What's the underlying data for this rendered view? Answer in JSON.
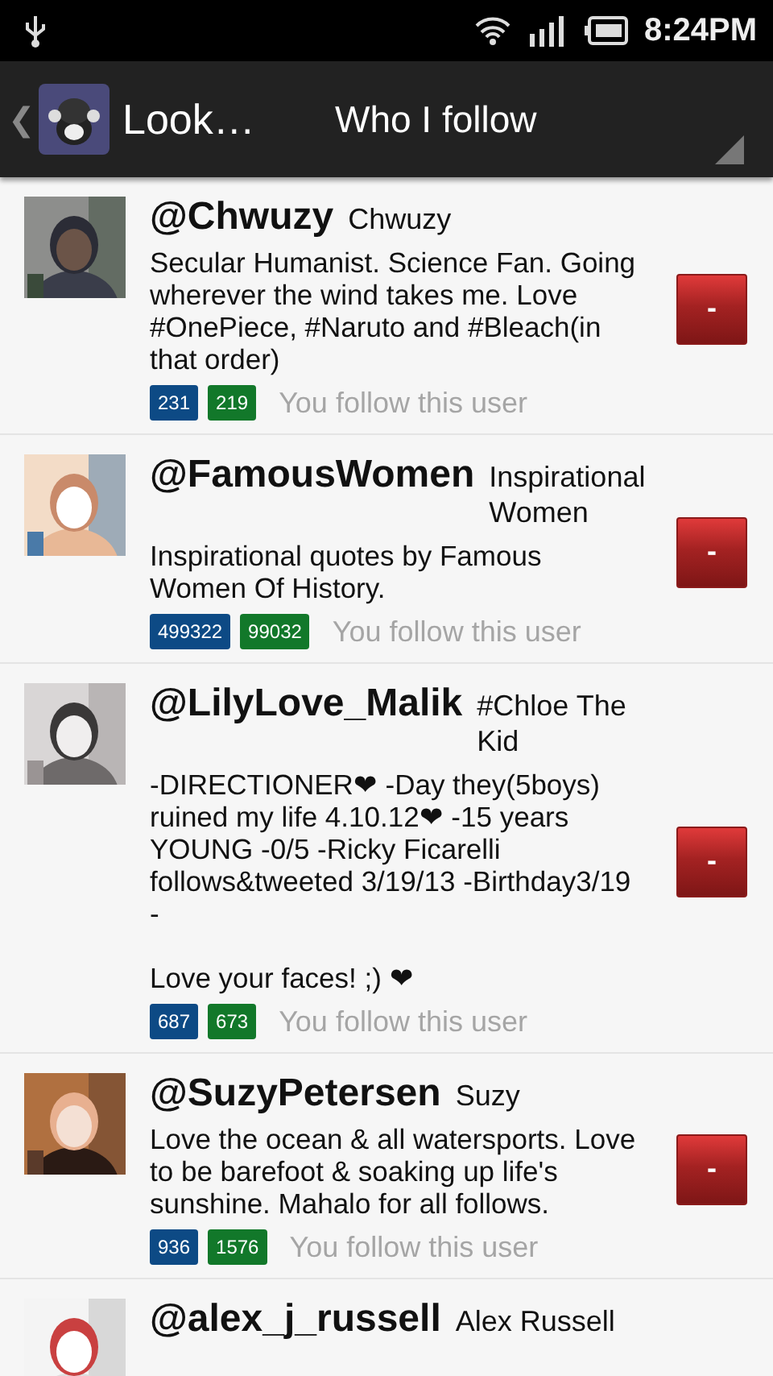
{
  "status_bar": {
    "time": "8:24PM"
  },
  "action_bar": {
    "back": "❮",
    "app_title": "Look…",
    "title": "Who I follow"
  },
  "users": [
    {
      "handle": "@Chwuzy",
      "name": "Chwuzy",
      "bio": "Secular Humanist. Science Fan. Going wherever the wind takes me. Love #OnePiece, #Naruto and #Bleach(in that order)",
      "followers": "231",
      "following": "219",
      "status": "You follow this user",
      "remove": "-"
    },
    {
      "handle": "@FamousWomen",
      "name": "Inspirational Women",
      "bio": "Inspirational quotes by Famous Women Of History.",
      "followers": "499322",
      "following": "99032",
      "status": "You follow this user",
      "remove": "-"
    },
    {
      "handle": "@LilyLove_Malik",
      "name": "#Chloe The Kid",
      "bio": "-DIRECTIONER❤ -Day they(5boys) ruined my life 4.10.12❤ -15 years YOUNG -0/5 -Ricky Ficarelli follows&tweeted 3/19/13 -Birthday3/19\n-\n\nLove your faces! ;) ❤",
      "followers": "687",
      "following": "673",
      "status": "You follow this user",
      "remove": "-"
    },
    {
      "handle": "@SuzyPetersen",
      "name": "Suzy",
      "bio": "Love the ocean & all watersports. Love to be barefoot & soaking up life's sunshine. Mahalo for all follows.",
      "followers": "936",
      "following": "1576",
      "status": "You follow this user",
      "remove": "-"
    },
    {
      "handle": "@alex_j_russell",
      "name": "Alex Russell"
    }
  ]
}
